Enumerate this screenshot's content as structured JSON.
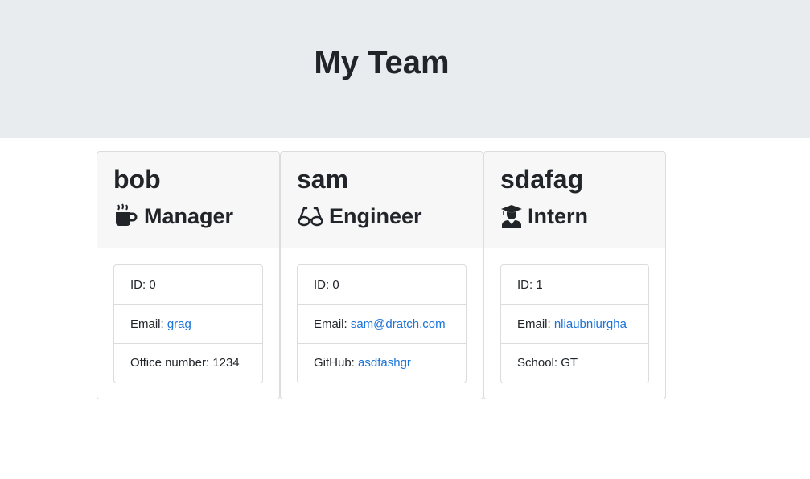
{
  "header": {
    "title": "My Team"
  },
  "cards": [
    {
      "name": "bob",
      "role": "Manager",
      "icon": "coffee-mug-icon",
      "id_label": "ID: ",
      "id_value": "0",
      "email_label": "Email: ",
      "email_value": "grag",
      "extra_label": "Office number: ",
      "extra_value": "1234"
    },
    {
      "name": "sam",
      "role": "Engineer",
      "icon": "glasses-icon",
      "id_label": "ID: ",
      "id_value": "0",
      "email_label": "Email: ",
      "email_value": "sam@dratch.com",
      "extra_label": "GitHub: ",
      "extra_value": "asdfashgr"
    },
    {
      "name": "sdafag",
      "role": "Intern",
      "icon": "graduate-icon",
      "id_label": "ID: ",
      "id_value": "1",
      "email_label": "Email: ",
      "email_value": "nliaubniurgha",
      "extra_label": "School: ",
      "extra_value": "GT"
    }
  ],
  "colors": {
    "header_bg": "#e9ecef",
    "card_header_bg": "#f7f7f7",
    "link": "#1a73d9",
    "text": "#212529"
  }
}
